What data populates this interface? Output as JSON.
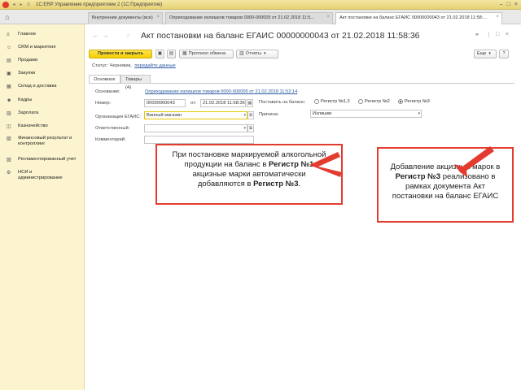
{
  "window": {
    "title": "1С:ERP Управление предприятием 2  (1С:Предприятие)"
  },
  "tabs": [
    {
      "label": "Внутренние документы (все)"
    },
    {
      "label": "Оприходование излишков товаров 0000-000005 от 21.02.2018 11:5..."
    },
    {
      "label": "Акт постановки на баланс ЕГАИС 00000000043 от 21.02.2018 11:58:..."
    }
  ],
  "sidebar": {
    "items": [
      {
        "label": "Главное",
        "icon": "menu-icon"
      },
      {
        "label": "CRM и маркетинг",
        "icon": "crm-icon"
      },
      {
        "label": "Продажи",
        "icon": "sales-icon"
      },
      {
        "label": "Закупки",
        "icon": "purchases-icon"
      },
      {
        "label": "Склад и доставка",
        "icon": "warehouse-icon"
      },
      {
        "label": "Кадры",
        "icon": "staff-icon"
      },
      {
        "label": "Зарплата",
        "icon": "salary-icon"
      },
      {
        "label": "Казначейство",
        "icon": "treasury-icon"
      },
      {
        "label": "Финансовый результат и контроллинг",
        "icon": "finance-icon"
      },
      {
        "label": "Регламентированный учет",
        "icon": "accounting-icon"
      },
      {
        "label": "НСИ и администрирование",
        "icon": "admin-icon"
      }
    ]
  },
  "document": {
    "title": "Акт постановки на баланс ЕГАИС 00000000043 от 21.02.2018 11:58:36",
    "status_label": "Статус:",
    "status_value": "Черновик,",
    "status_link": "передайте данные"
  },
  "toolbar": {
    "post_close": "Провести и закрыть",
    "exchange_log": "Протокол обмена",
    "reports": "Отчеты",
    "more": "Еще"
  },
  "form_tabs": [
    {
      "label": "Основное"
    },
    {
      "label": "Товары (4)"
    }
  ],
  "form": {
    "basis_label": "Основание:",
    "basis_link": "Оприходование излишков товаров 0000-000005 от 21.02.2018 11:52:14",
    "number_label": "Номер:",
    "number_value": "00000000043",
    "from_label": "от:",
    "date_value": "21.02.2018 11:58:36",
    "register_label": "Поставить на баланс:",
    "registers": [
      "Регистр №1,3",
      "Регистр №2",
      "Регистр №3"
    ],
    "selected_register": "Регистр №3",
    "org_label": "Организация ЕГАИС:",
    "org_value": "Винный магазин",
    "reason_label": "Причина:",
    "reason_value": "Излишки",
    "responsible_label": "Ответственный:",
    "responsible_value": "",
    "comment_label": "Комментарий:",
    "comment_value": ""
  },
  "callouts": {
    "left": {
      "line1": "При постановке маркируемой алкогольной",
      "line2_a": "продукции на баланс в",
      "line2_b": "Регистр №1",
      "line3": "акцизные марки автоматически",
      "line4_a": "добавляются в",
      "line4_b": "Регистр №3",
      "line4_c": "."
    },
    "right": {
      "line1": "Добавление акцизных марок в",
      "line2_a": "Регистр №3",
      "line2_b": "реализовано в",
      "line3": "рамках документа Акт",
      "line4": "постановки на баланс ЕГАИС"
    }
  },
  "colors": {
    "accent_yellow": "#f4cf00",
    "sidebar_bg": "#fbf4cf",
    "link_blue": "#2a5aa0",
    "callout_red": "#e33c2f"
  }
}
